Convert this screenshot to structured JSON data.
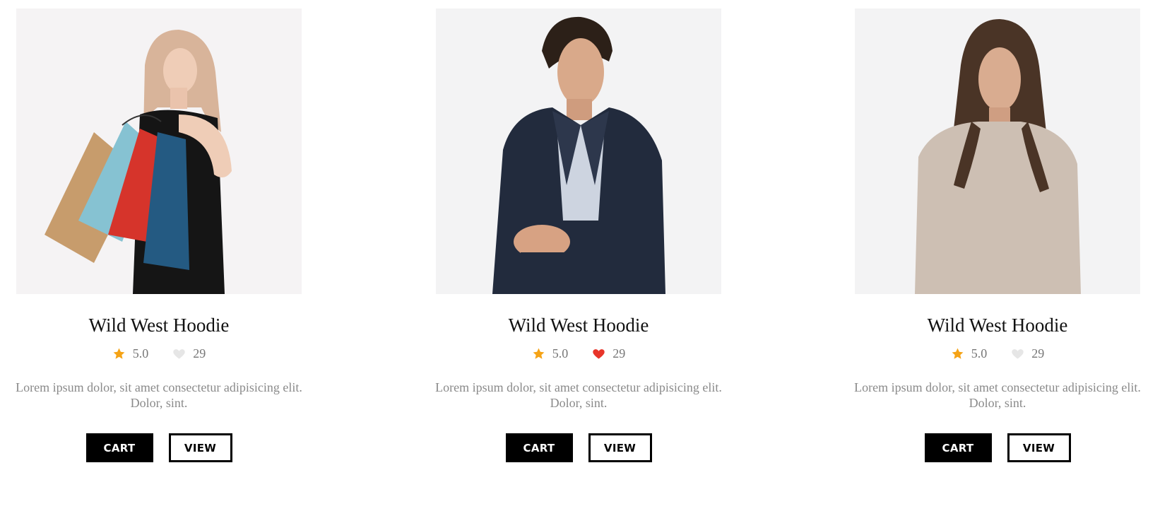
{
  "colors": {
    "star": "#f5a316",
    "heart_inactive": "#e6e6e6",
    "heart_active": "#e8352a",
    "image_bg": "#f3f3f4"
  },
  "products": [
    {
      "image_alt": "woman with shopping bags",
      "title": "Wild West Hoodie",
      "rating": "5.0",
      "likes": "29",
      "liked": false,
      "description": "Lorem ipsum dolor, sit amet consectetur adipisicing elit. Dolor, sint.",
      "cart_label": "CART",
      "view_label": "VIEW"
    },
    {
      "image_alt": "man in navy suit",
      "title": "Wild West Hoodie",
      "rating": "5.0",
      "likes": "29",
      "liked": true,
      "description": "Lorem ipsum dolor, sit amet consectetur adipisicing elit. Dolor, sint.",
      "cart_label": "CART",
      "view_label": "VIEW"
    },
    {
      "image_alt": "woman in beige sweater",
      "title": "Wild West Hoodie",
      "rating": "5.0",
      "likes": "29",
      "liked": false,
      "description": "Lorem ipsum dolor, sit amet consectetur adipisicing elit. Dolor, sint.",
      "cart_label": "CART",
      "view_label": "VIEW"
    }
  ]
}
